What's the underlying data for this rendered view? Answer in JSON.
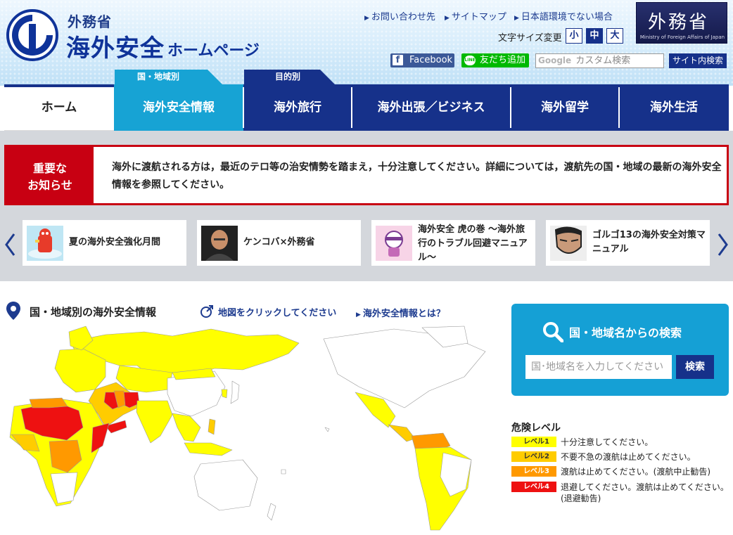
{
  "header": {
    "ministry": "外務省",
    "site_title": "海外安全",
    "site_title_sub": "ホームページ",
    "links": [
      "お問い合わせ先",
      "サイトマップ",
      "日本語環境でない場合"
    ],
    "badge_kanji": "外務省",
    "badge_english": "Ministry of Foreign Affairs of Japan",
    "font_size_label": "文字サイズ変更",
    "font_sizes": [
      "小",
      "中",
      "大"
    ],
    "font_size_selected": "中",
    "facebook": "Facebook",
    "line": "友だち追加",
    "line_icon_text": "LINE",
    "search_brand": "Google",
    "search_placeholder": "カスタム検索",
    "search_button": "サイト内検索"
  },
  "nav": {
    "tag_country": "国・地域別",
    "tag_purpose": "目的別",
    "items": [
      "ホーム",
      "海外安全情報",
      "海外旅行",
      "海外出張／ビジネス",
      "海外留学",
      "海外生活"
    ]
  },
  "notice": {
    "label_line1": "重要な",
    "label_line2": "お知らせ",
    "text": "海外に渡航される方は，最近のテロ等の治安情勢を踏まえ，十分注意してください。詳細については，渡航先の国・地域の最新の海外安全情報を参照してください。"
  },
  "carousel": [
    {
      "title": "夏の海外安全強化月間"
    },
    {
      "title": "ケンコバ×外務省"
    },
    {
      "title": "海外安全 虎の巻 ～海外旅行のトラブル回避マニュアル～"
    },
    {
      "title": "ゴルゴ13の海外安全対策マニュアル"
    }
  ],
  "map_section": {
    "title": "国・地域別の海外安全情報",
    "click_hint": "地図をクリックしてください",
    "what_is": "海外安全情報とは？"
  },
  "country_search": {
    "title": "国・地域名からの検索",
    "placeholder": "国･地域名を入力してください",
    "button": "検索"
  },
  "danger_legend": {
    "title": "危険レベル",
    "levels": [
      {
        "label": "レベル1",
        "desc": "十分注意してください。",
        "color": "#ffff00"
      },
      {
        "label": "レベル2",
        "desc": "不要不急の渡航は止めてください。",
        "color": "#ffcc00"
      },
      {
        "label": "レベル3",
        "desc": "渡航は止めてください。(渡航中止勧告)",
        "color": "#ff9900"
      },
      {
        "label": "レベル4",
        "desc": "退避してください。渡航は止めてください。(退避勧告)",
        "color": "#ee1111"
      }
    ]
  },
  "colors": {
    "navy": "#16318a",
    "cyan": "#17a3d4",
    "notice_red": "#c80012",
    "level1": "#ffff00",
    "level2": "#ffcc00",
    "level3": "#ff9900",
    "level4": "#ee1111"
  }
}
